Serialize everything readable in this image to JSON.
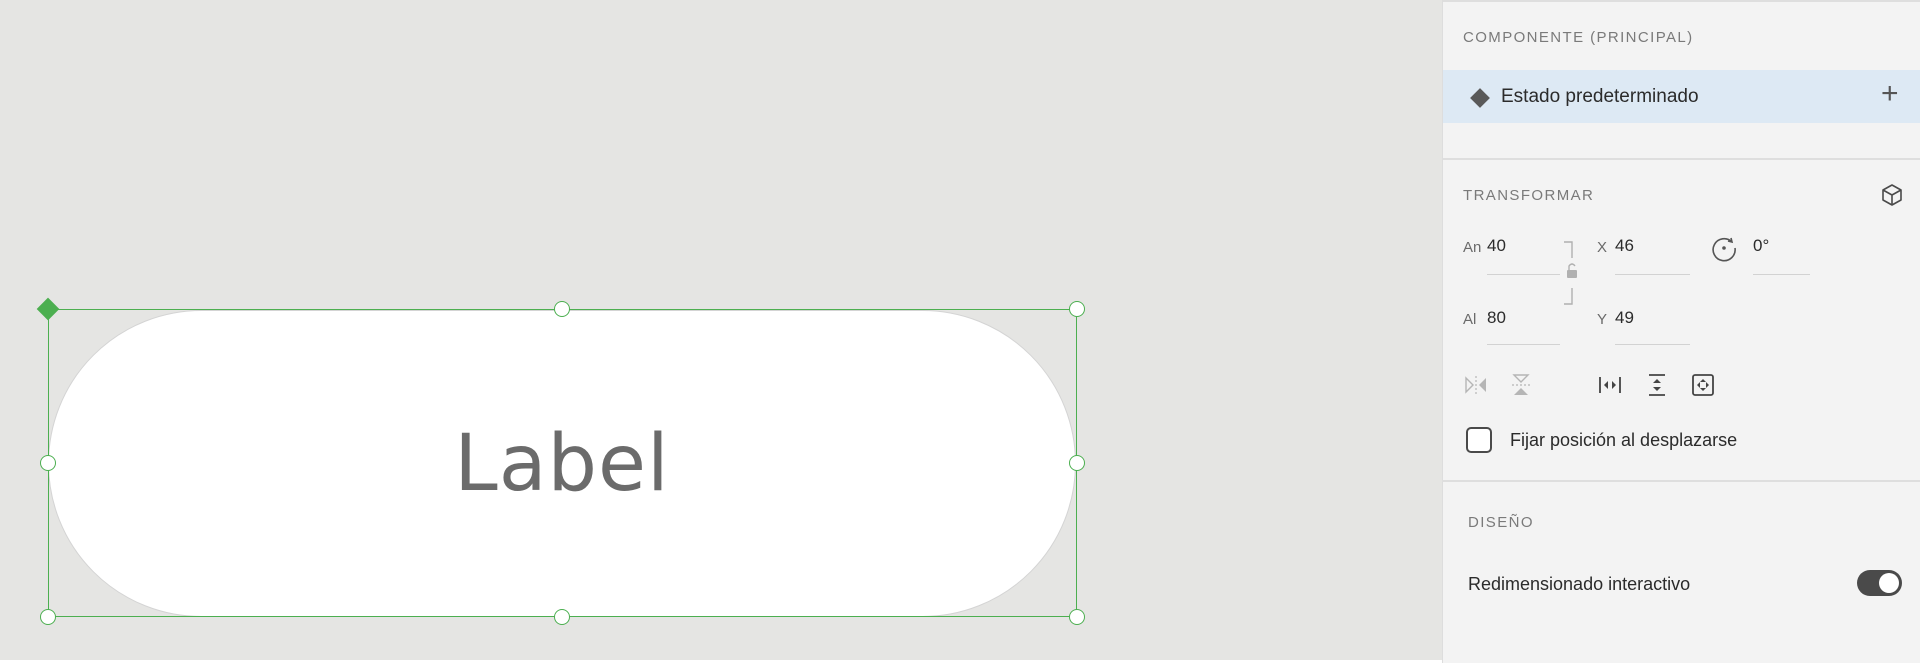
{
  "canvas": {
    "component_text": "Label",
    "selection_color": "#4caf50"
  },
  "panel": {
    "component_section": {
      "title": "COMPONENTE (PRINCIPAL)",
      "state_label": "Estado predeterminado",
      "add_state_icon": "plus-icon",
      "row_color": "#dde9f4"
    },
    "transform_section": {
      "title": "TRANSFORMAR",
      "icon": "cube-icon",
      "width_label": "An",
      "width_value": "40",
      "height_label": "Al",
      "height_value": "80",
      "x_label": "X",
      "x_value": "46",
      "y_label": "Y",
      "y_value": "49",
      "rotation_value": "0°",
      "fix_position_label": "Fijar posición al desplazarse",
      "fix_position_checked": false,
      "tool_icons": [
        "flip-horizontal-icon",
        "flip-vertical-icon",
        "distribute-horizontal-icon",
        "distribute-vertical-icon",
        "fit-content-icon"
      ]
    },
    "design_section": {
      "title": "DISEÑO",
      "responsive_resize_label": "Redimensionado interactivo",
      "responsive_resize_on": true
    }
  }
}
